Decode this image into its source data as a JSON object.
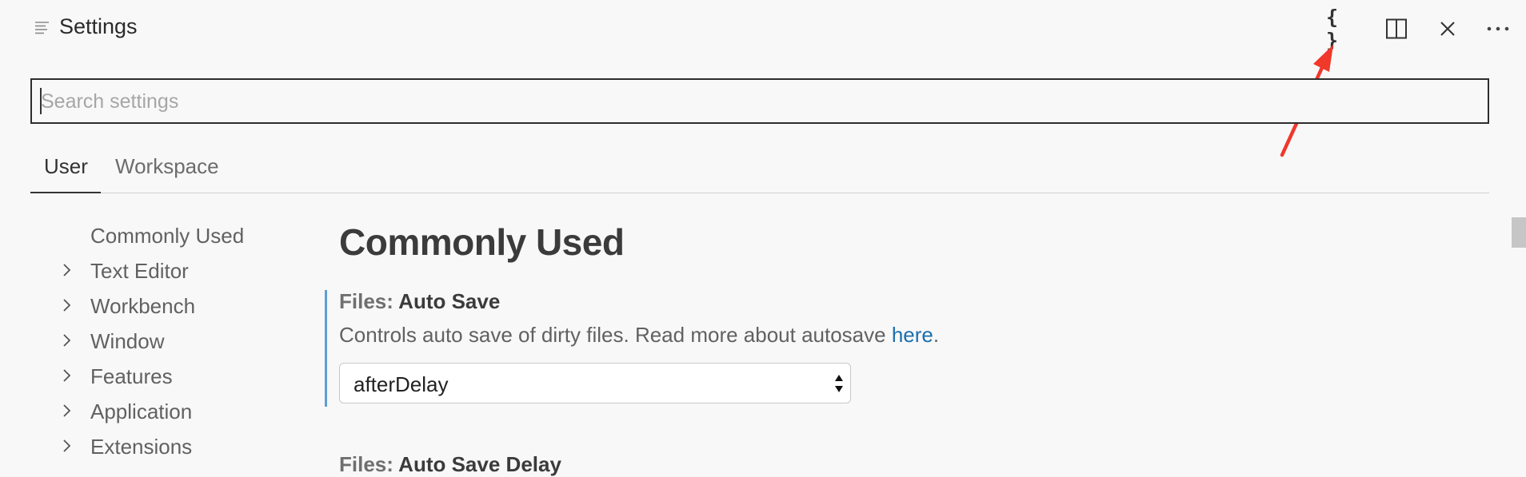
{
  "header": {
    "title": "Settings",
    "actions": {
      "open_json": "{ }",
      "split": "split-editor-icon",
      "close": "close-icon",
      "more": "more-icon"
    }
  },
  "search": {
    "placeholder": "Search settings",
    "value": ""
  },
  "tabs": [
    {
      "label": "User",
      "active": true
    },
    {
      "label": "Workspace",
      "active": false
    }
  ],
  "toc": [
    {
      "label": "Commonly Used",
      "expandable": false
    },
    {
      "label": "Text Editor",
      "expandable": true
    },
    {
      "label": "Workbench",
      "expandable": true
    },
    {
      "label": "Window",
      "expandable": true
    },
    {
      "label": "Features",
      "expandable": true
    },
    {
      "label": "Application",
      "expandable": true
    },
    {
      "label": "Extensions",
      "expandable": true
    }
  ],
  "content": {
    "section_title": "Commonly Used",
    "settings": [
      {
        "category": "Files: ",
        "name": "Auto Save",
        "description": "Controls auto save of dirty files. Read more about autosave ",
        "link_text": "here",
        "description_end": ".",
        "value": "afterDelay"
      },
      {
        "category": "Files: ",
        "name": "Auto Save Delay"
      }
    ]
  },
  "colors": {
    "accent_bar": "#5f9ed1",
    "link": "#1a6fae",
    "annotation_arrow": "#f0382b"
  }
}
